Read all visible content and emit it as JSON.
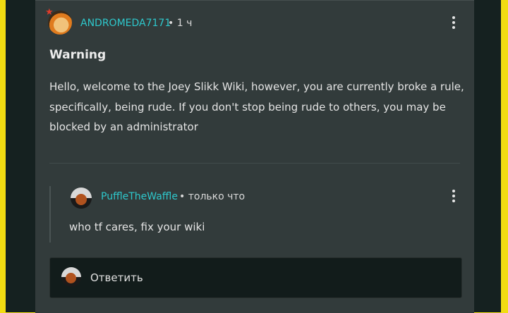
{
  "post": {
    "author": "ANDROMEDA7171",
    "separator": "•",
    "time": "1 ч",
    "title": "Warning",
    "body": "Hello, welcome to the Joey Slikk Wiki, however, you are currently broke a rule, specifically, being rude. If you don't stop being rude to others, you may be blocked by an administrator",
    "badge_icon": "star-icon",
    "menu_icon": "kebab-menu-icon"
  },
  "reply": {
    "author": "PuffleTheWaffle",
    "separator": "•",
    "time": "только что",
    "text": "who tf cares, fix your wiki",
    "menu_icon": "kebab-menu-icon"
  },
  "reply_box": {
    "placeholder": "Ответить"
  },
  "colors": {
    "accent": "#2ec8cc",
    "card_bg": "#323b3b",
    "page_border": "#f2dc12",
    "text": "#e4e4e4"
  }
}
